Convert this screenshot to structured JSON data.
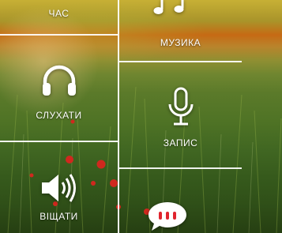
{
  "tiles": {
    "clock": {
      "label": "ЧАС"
    },
    "music": {
      "label": "МУЗИКА",
      "icon": "music-note-icon"
    },
    "listen": {
      "label": "СЛУХАТИ",
      "icon": "headphones-icon"
    },
    "record": {
      "label": "ЗАПИС",
      "icon": "microphone-icon"
    },
    "broadcast": {
      "label": "ВІЩАТИ",
      "icon": "speaker-icon"
    },
    "chat": {
      "icon": "chat-bubble-icon"
    }
  },
  "colors": {
    "text": "#ffffff",
    "divider": "#ffffff",
    "chat_dots": "#e0242e"
  }
}
